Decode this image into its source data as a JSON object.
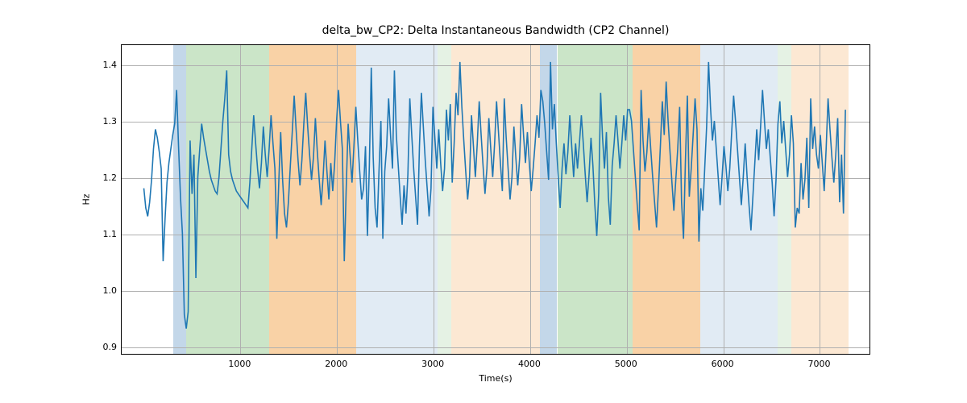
{
  "chart_data": {
    "type": "line",
    "title": "delta_bw_CP2: Delta Instantaneous Bandwidth (CP2 Channel)",
    "xlabel": "Time(s)",
    "ylabel": "Hz",
    "xlim": [
      -230,
      7530
    ],
    "ylim": [
      0.885,
      1.435
    ],
    "xticks": [
      1000,
      2000,
      3000,
      4000,
      5000,
      6000,
      7000
    ],
    "yticks": [
      0.9,
      1.0,
      1.1,
      1.2,
      1.3,
      1.4
    ],
    "bands": [
      {
        "x0": 300,
        "x1": 440,
        "color": "#a9c6df",
        "alpha": 0.7
      },
      {
        "x0": 440,
        "x1": 1300,
        "color": "#b4dab1",
        "alpha": 0.7
      },
      {
        "x0": 1300,
        "x1": 2200,
        "color": "#f7be80",
        "alpha": 0.7
      },
      {
        "x0": 2200,
        "x1": 3040,
        "color": "#a9c6df",
        "alpha": 0.35
      },
      {
        "x0": 3040,
        "x1": 3180,
        "color": "#b4dab1",
        "alpha": 0.35
      },
      {
        "x0": 3180,
        "x1": 4100,
        "color": "#f7be80",
        "alpha": 0.35
      },
      {
        "x0": 4100,
        "x1": 4280,
        "color": "#a9c6df",
        "alpha": 0.7
      },
      {
        "x0": 4280,
        "x1": 5060,
        "color": "#b4dab1",
        "alpha": 0.7
      },
      {
        "x0": 5060,
        "x1": 5760,
        "color": "#f7be80",
        "alpha": 0.7
      },
      {
        "x0": 5760,
        "x1": 6560,
        "color": "#a9c6df",
        "alpha": 0.35
      },
      {
        "x0": 6560,
        "x1": 6700,
        "color": "#b4dab1",
        "alpha": 0.35
      },
      {
        "x0": 6700,
        "x1": 7300,
        "color": "#f7be80",
        "alpha": 0.35
      }
    ],
    "series": [
      {
        "name": "delta_bw_CP2",
        "color": "#1f77b4",
        "x_start": 0,
        "x_step": 20,
        "values": [
          1.18,
          1.145,
          1.13,
          1.155,
          1.195,
          1.25,
          1.285,
          1.27,
          1.245,
          1.215,
          1.05,
          1.125,
          1.19,
          1.225,
          1.25,
          1.275,
          1.295,
          1.355,
          1.255,
          1.165,
          1.1,
          0.955,
          0.93,
          0.96,
          1.265,
          1.17,
          1.24,
          1.02,
          1.2,
          1.25,
          1.295,
          1.27,
          1.25,
          1.23,
          1.21,
          1.195,
          1.185,
          1.175,
          1.17,
          1.2,
          1.25,
          1.3,
          1.34,
          1.39,
          1.24,
          1.21,
          1.195,
          1.185,
          1.175,
          1.17,
          1.165,
          1.16,
          1.155,
          1.15,
          1.145,
          1.19,
          1.25,
          1.31,
          1.26,
          1.215,
          1.18,
          1.225,
          1.29,
          1.24,
          1.2,
          1.25,
          1.31,
          1.26,
          1.215,
          1.09,
          1.19,
          1.28,
          1.195,
          1.135,
          1.11,
          1.155,
          1.22,
          1.28,
          1.345,
          1.285,
          1.23,
          1.185,
          1.23,
          1.295,
          1.35,
          1.29,
          1.24,
          1.195,
          1.235,
          1.305,
          1.245,
          1.195,
          1.15,
          1.2,
          1.265,
          1.21,
          1.16,
          1.225,
          1.175,
          1.225,
          1.3,
          1.355,
          1.3,
          1.25,
          1.05,
          1.18,
          1.295,
          1.24,
          1.19,
          1.255,
          1.325,
          1.265,
          1.21,
          1.16,
          1.18,
          1.255,
          1.095,
          1.22,
          1.395,
          1.235,
          1.145,
          1.11,
          1.21,
          1.3,
          1.09,
          1.21,
          1.255,
          1.34,
          1.275,
          1.215,
          1.39,
          1.275,
          1.22,
          1.165,
          1.115,
          1.185,
          1.135,
          1.205,
          1.34,
          1.275,
          1.215,
          1.165,
          1.115,
          1.255,
          1.35,
          1.29,
          1.23,
          1.18,
          1.13,
          1.18,
          1.325,
          1.27,
          1.215,
          1.285,
          1.225,
          1.175,
          1.215,
          1.32,
          1.265,
          1.33,
          1.19,
          1.26,
          1.35,
          1.31,
          1.405,
          1.325,
          1.265,
          1.21,
          1.16,
          1.2,
          1.31,
          1.255,
          1.2,
          1.26,
          1.335,
          1.275,
          1.22,
          1.17,
          1.215,
          1.305,
          1.25,
          1.2,
          1.26,
          1.335,
          1.28,
          1.225,
          1.175,
          1.34,
          1.27,
          1.215,
          1.16,
          1.2,
          1.29,
          1.235,
          1.185,
          1.235,
          1.33,
          1.275,
          1.225,
          1.28,
          1.225,
          1.175,
          1.215,
          1.26,
          1.31,
          1.27,
          1.355,
          1.335,
          1.295,
          1.245,
          1.195,
          1.405,
          1.285,
          1.33,
          1.26,
          1.2,
          1.145,
          1.215,
          1.26,
          1.205,
          1.245,
          1.31,
          1.255,
          1.2,
          1.26,
          1.215,
          1.26,
          1.31,
          1.26,
          1.205,
          1.155,
          1.205,
          1.27,
          1.22,
          1.15,
          1.095,
          1.17,
          1.35,
          1.27,
          1.215,
          1.28,
          1.165,
          1.115,
          1.22,
          1.26,
          1.31,
          1.265,
          1.215,
          1.26,
          1.31,
          1.265,
          1.32,
          1.32,
          1.3,
          1.25,
          1.2,
          1.15,
          1.105,
          1.355,
          1.265,
          1.21,
          1.245,
          1.305,
          1.25,
          1.2,
          1.155,
          1.11,
          1.18,
          1.255,
          1.335,
          1.275,
          1.37,
          1.3,
          1.245,
          1.19,
          1.14,
          1.195,
          1.25,
          1.325,
          1.155,
          1.09,
          1.23,
          1.345,
          1.165,
          1.215,
          1.275,
          1.34,
          1.285,
          1.085,
          1.18,
          1.14,
          1.215,
          1.29,
          1.405,
          1.325,
          1.265,
          1.3,
          1.25,
          1.2,
          1.15,
          1.2,
          1.255,
          1.22,
          1.175,
          1.215,
          1.28,
          1.345,
          1.3,
          1.25,
          1.2,
          1.15,
          1.2,
          1.26,
          1.2,
          1.15,
          1.105,
          1.165,
          1.225,
          1.285,
          1.23,
          1.29,
          1.355,
          1.3,
          1.25,
          1.285,
          1.235,
          1.19,
          1.13,
          1.195,
          1.295,
          1.335,
          1.26,
          1.3,
          1.25,
          1.2,
          1.24,
          1.31,
          1.26,
          1.11,
          1.145,
          1.135,
          1.225,
          1.16,
          1.195,
          1.27,
          1.145,
          1.34,
          1.25,
          1.29,
          1.24,
          1.215,
          1.275,
          1.225,
          1.175,
          1.25,
          1.34,
          1.285,
          1.235,
          1.19,
          1.24,
          1.305,
          1.155,
          1.24,
          1.135,
          1.32
        ]
      }
    ]
  }
}
